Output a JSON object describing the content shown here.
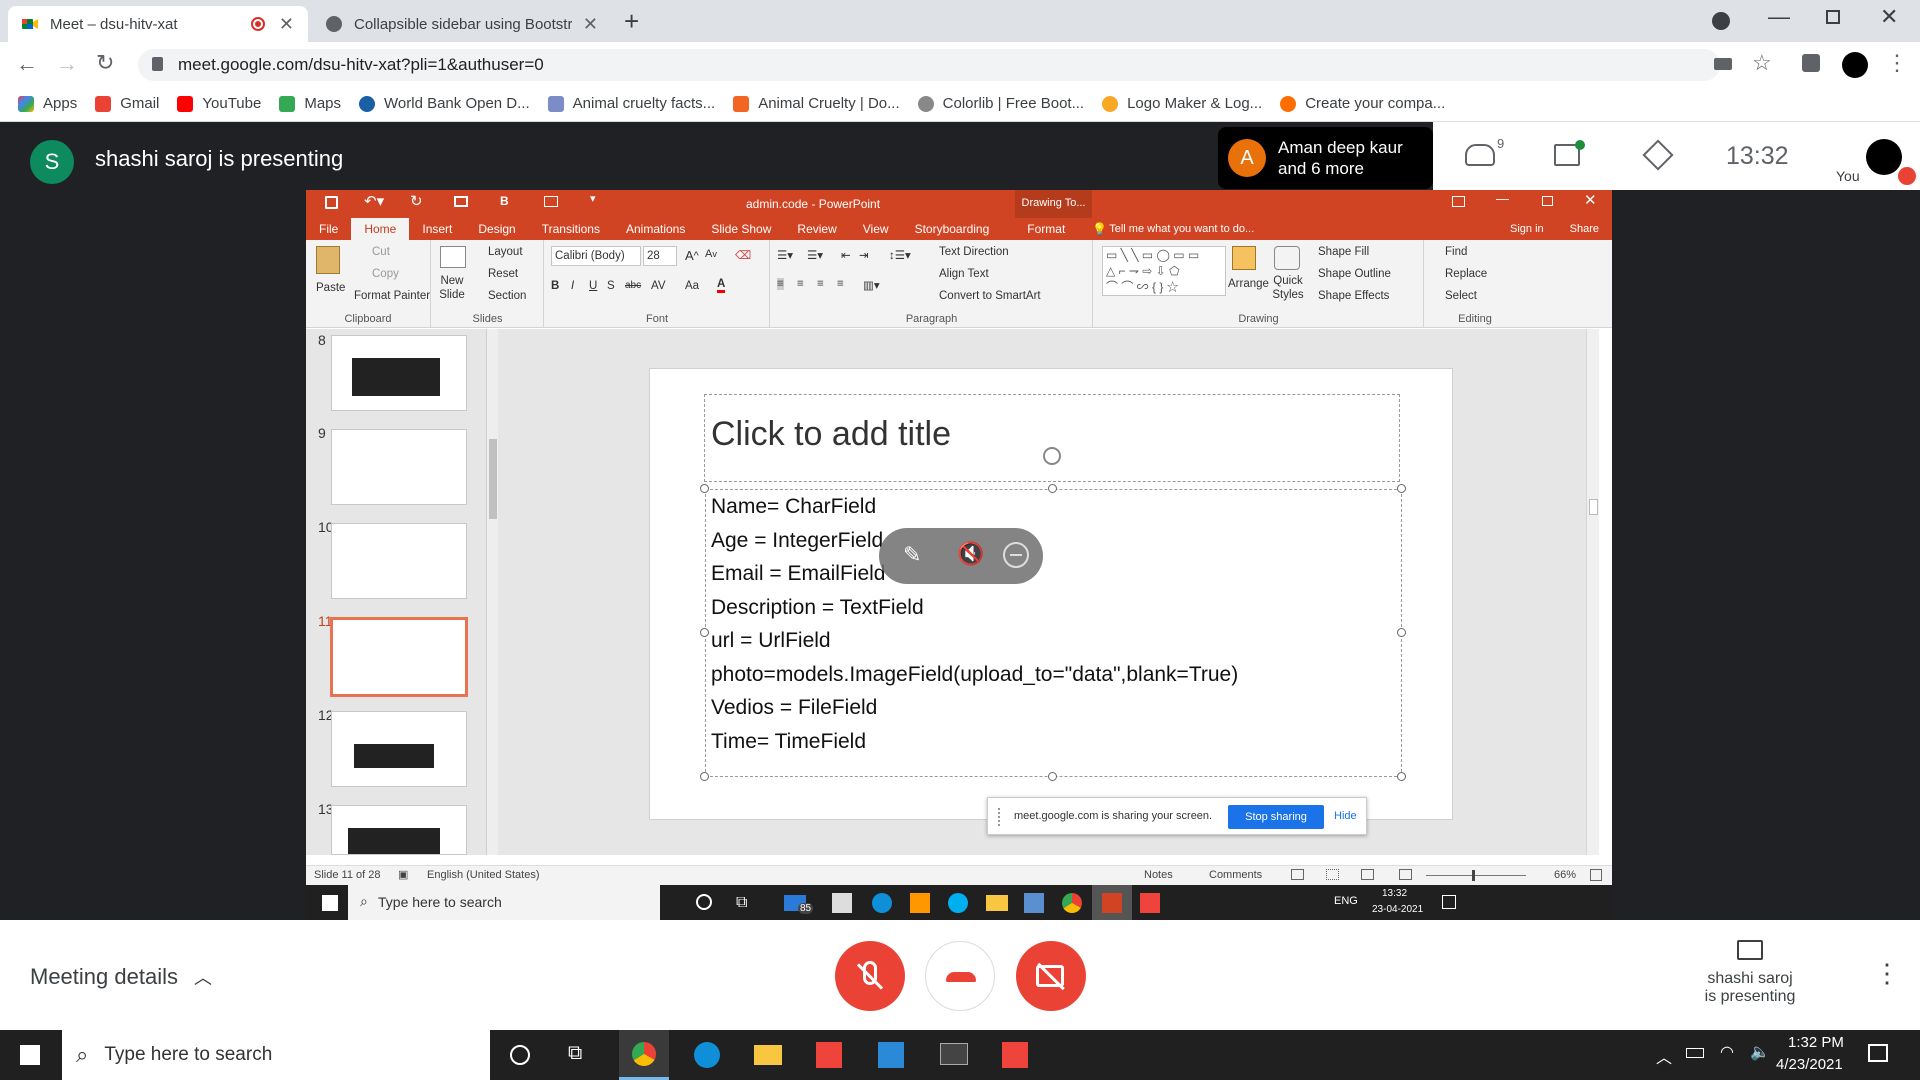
{
  "chrome": {
    "tabs": [
      {
        "title": "Meet – dsu-hitv-xat",
        "active": true
      },
      {
        "title": "Collapsible sidebar using Bootstr",
        "active": false
      }
    ],
    "address": "meet.google.com/dsu-hitv-xat?pli=1&authuser=0",
    "bookmarks": [
      "Apps",
      "Gmail",
      "YouTube",
      "Maps",
      "World Bank Open D...",
      "Animal cruelty facts...",
      "Animal Cruelty | Do...",
      "Colorlib | Free Boot...",
      "Logo Maker & Log...",
      "Create your compa..."
    ]
  },
  "meet": {
    "presenter_initial": "S",
    "presenting_text": "shashi saroj is presenting",
    "participants_initial": "A",
    "participants_text": "Aman deep kaur and 6 more",
    "people_count": "9",
    "time": "13:32",
    "you_label": "You",
    "meeting_details": "Meeting details",
    "presenting_line1": "shashi saroj",
    "presenting_line2": "is presenting"
  },
  "ppt": {
    "window_title": "admin.code - PowerPoint",
    "contextual_tab": "Drawing To...",
    "tabs": [
      "File",
      "Home",
      "Insert",
      "Design",
      "Transitions",
      "Animations",
      "Slide Show",
      "Review",
      "View",
      "Storyboarding",
      "Format"
    ],
    "tell_me": "Tell me what you want to do...",
    "sign_in": "Sign in",
    "share": "Share",
    "ribbon": {
      "clipboard": {
        "label": "Clipboard",
        "paste": "Paste",
        "cut": "Cut",
        "copy": "Copy",
        "format_painter": "Format Painter"
      },
      "slides": {
        "label": "Slides",
        "new_slide": "New Slide",
        "layout": "Layout",
        "reset": "Reset",
        "section": "Section"
      },
      "font": {
        "label": "Font",
        "font_name": "Calibri (Body)",
        "font_size": "28"
      },
      "paragraph": {
        "label": "Paragraph",
        "text_direction": "Text Direction",
        "align_text": "Align Text",
        "convert_smartart": "Convert to SmartArt"
      },
      "drawing": {
        "label": "Drawing",
        "arrange": "Arrange",
        "quick_styles": "Quick Styles",
        "shape_fill": "Shape Fill",
        "shape_outline": "Shape Outline",
        "shape_effects": "Shape Effects"
      },
      "editing": {
        "label": "Editing",
        "find": "Find",
        "replace": "Replace",
        "select": "Select"
      }
    },
    "thumb_numbers": [
      "8",
      "9",
      "10",
      "11",
      "12",
      "13"
    ],
    "slide": {
      "title_placeholder": "Click to add title",
      "lines": [
        "Name= CharField",
        "Age = IntegerField",
        "Email = EmailField",
        "Description = TextField",
        "url = UrlField",
        "photo=models.ImageField(upload_to=\"data\",blank=True)",
        "Vedios = FileField",
        "Time= TimeField"
      ]
    },
    "sharing_bar": {
      "text": "meet.google.com is sharing your screen.",
      "stop": "Stop sharing",
      "hide": "Hide"
    },
    "status": {
      "slide": "Slide 11 of 28",
      "language": "English (United States)",
      "notes": "Notes",
      "comments": "Comments",
      "zoom": "66%"
    },
    "inner_taskbar": {
      "search": "Type here to search",
      "lang": "ENG",
      "time": "13:32",
      "date": "23-04-2021",
      "mail_badge": "85"
    }
  },
  "taskbar": {
    "search": "Type here to search",
    "time": "1:32 PM",
    "date": "4/23/2021"
  },
  "colors": {
    "ppt_red": "#d04423",
    "meet_red": "#ea4335",
    "meet_bg": "#202124",
    "stop_blue": "#1a73e8"
  }
}
